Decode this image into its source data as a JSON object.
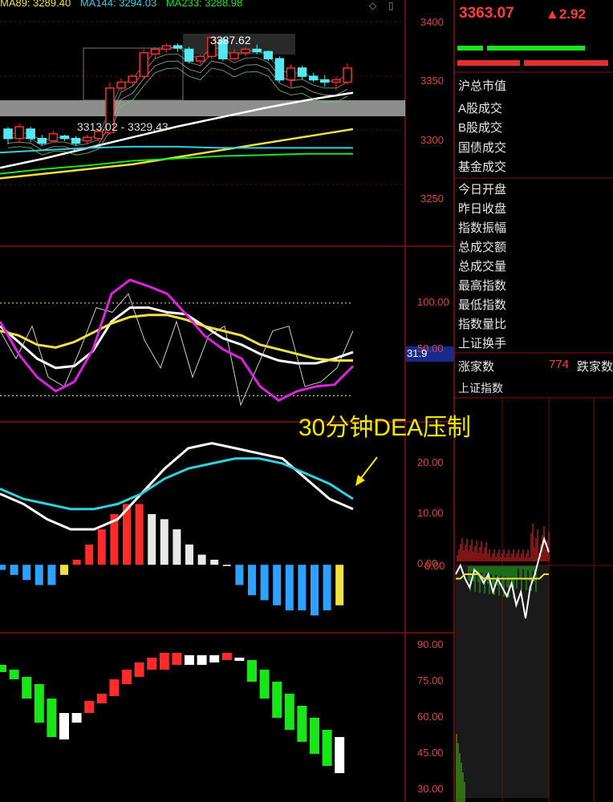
{
  "legend": {
    "ma89": "MA89: 3289.40",
    "ma144": "MA144: 3294.03",
    "ma233": "MA233: 3288.98"
  },
  "quote": {
    "price": "3363.07",
    "change": "▲2.92"
  },
  "stats_labels": [
    "沪总市值",
    "A股成交",
    "B股成交",
    "国债成交",
    "基金成交",
    "今日开盘",
    "昨日收盘",
    "指数振幅",
    "总成交额",
    "总成交量",
    "最高指数",
    "最低指数",
    "指数量比",
    "上证换手"
  ],
  "breadth": {
    "up_label": "涨家数",
    "up_value": "774",
    "down_label": "跌家数"
  },
  "mini_chart_title": "上证指数",
  "annotation": "30分钟DEA压制",
  "right_panel_axis": {
    "intraday_zero": "0.00"
  },
  "colors": {
    "up": "#ff2a2a",
    "down_candle": "#54e8f0",
    "white_line": "#ffffff",
    "yellow_line": "#f0e040",
    "magenta_line": "#e020e0",
    "cyan_line": "#30d0e0",
    "macd_neg": "#2ea0ff",
    "green_bar": "#19e619",
    "annotation": "#f5e600"
  },
  "chart_data": [
    {
      "type": "candlestick",
      "panel": "price",
      "annotations": [
        "3387.62",
        "3313.02 - 3329.43"
      ],
      "yticks": [
        3400,
        3350,
        3300,
        3250
      ],
      "ylim": [
        3215,
        3420
      ],
      "candles": [
        {
          "o": 3310,
          "c": 3302,
          "h": 3312,
          "l": 3297
        },
        {
          "o": 3302,
          "c": 3312,
          "h": 3315,
          "l": 3298
        },
        {
          "o": 3310,
          "c": 3302,
          "h": 3312,
          "l": 3299
        },
        {
          "o": 3302,
          "c": 3298,
          "h": 3305,
          "l": 3296
        },
        {
          "o": 3300,
          "c": 3306,
          "h": 3308,
          "l": 3299
        },
        {
          "o": 3304,
          "c": 3302,
          "h": 3305,
          "l": 3300
        },
        {
          "o": 3302,
          "c": 3298,
          "h": 3304,
          "l": 3296
        },
        {
          "o": 3300,
          "c": 3303,
          "h": 3305,
          "l": 3297
        },
        {
          "o": 3302,
          "c": 3308,
          "h": 3310,
          "l": 3300
        },
        {
          "o": 3307,
          "c": 3345,
          "h": 3350,
          "l": 3305
        },
        {
          "o": 3345,
          "c": 3350,
          "h": 3353,
          "l": 3342
        },
        {
          "o": 3350,
          "c": 3355,
          "h": 3357,
          "l": 3347
        },
        {
          "o": 3355,
          "c": 3375,
          "h": 3378,
          "l": 3352
        },
        {
          "o": 3374,
          "c": 3378,
          "h": 3380,
          "l": 3370
        },
        {
          "o": 3378,
          "c": 3381,
          "h": 3383,
          "l": 3375
        },
        {
          "o": 3381,
          "c": 3379,
          "h": 3383,
          "l": 3376
        },
        {
          "o": 3378,
          "c": 3368,
          "h": 3380,
          "l": 3366
        },
        {
          "o": 3368,
          "c": 3372,
          "h": 3374,
          "l": 3365
        },
        {
          "o": 3372,
          "c": 3388,
          "h": 3388,
          "l": 3370
        },
        {
          "o": 3386,
          "c": 3370,
          "h": 3388,
          "l": 3368
        },
        {
          "o": 3370,
          "c": 3375,
          "h": 3378,
          "l": 3368
        },
        {
          "o": 3375,
          "c": 3378,
          "h": 3380,
          "l": 3372
        },
        {
          "o": 3378,
          "c": 3376,
          "h": 3382,
          "l": 3374
        },
        {
          "o": 3376,
          "c": 3370,
          "h": 3377,
          "l": 3368
        },
        {
          "o": 3370,
          "c": 3352,
          "h": 3372,
          "l": 3350
        },
        {
          "o": 3352,
          "c": 3362,
          "h": 3365,
          "l": 3346
        },
        {
          "o": 3362,
          "c": 3355,
          "h": 3364,
          "l": 3352
        },
        {
          "o": 3355,
          "c": 3352,
          "h": 3358,
          "l": 3350
        },
        {
          "o": 3352,
          "c": 3350,
          "h": 3356,
          "l": 3346
        },
        {
          "o": 3350,
          "c": 3352,
          "h": 3355,
          "l": 3343
        },
        {
          "o": 3350,
          "c": 3362,
          "h": 3366,
          "l": 3348
        }
      ],
      "ma_series": [
        {
          "color": "#ffffff",
          "values": [
            3277,
            3285,
            3294,
            3303,
            3312,
            3320,
            3328,
            3335,
            3341
          ]
        },
        {
          "color": "#f0e040",
          "values": [
            3268,
            3272,
            3276,
            3280,
            3286,
            3292,
            3298,
            3304,
            3310
          ]
        },
        {
          "color": "#30d0e0",
          "values": [
            3290,
            3292,
            3294,
            3295,
            3295,
            3294,
            3294,
            3294,
            3294
          ]
        },
        {
          "color": "#19e619",
          "values": [
            3272,
            3276,
            3279,
            3283,
            3285,
            3287,
            3288,
            3289,
            3289
          ]
        }
      ]
    },
    {
      "type": "line",
      "panel": "kdj",
      "yticks": [
        100,
        50
      ],
      "current_label": "31.9",
      "ylim": [
        -10,
        150
      ],
      "series": [
        {
          "color": "#ffffff",
          "values": [
            75,
            58,
            40,
            30,
            32,
            48,
            80,
            95,
            95,
            90,
            88,
            75,
            62,
            55,
            45,
            38,
            35,
            35,
            40,
            47
          ]
        },
        {
          "color": "#f0e040",
          "values": [
            70,
            65,
            55,
            52,
            58,
            68,
            78,
            85,
            87,
            87,
            82,
            75,
            70,
            65,
            55,
            50,
            45,
            40,
            38,
            38
          ]
        },
        {
          "color": "#e020e0",
          "values": [
            80,
            45,
            20,
            5,
            15,
            50,
            110,
            125,
            118,
            110,
            88,
            65,
            50,
            40,
            10,
            -5,
            5,
            10,
            12,
            32
          ]
        }
      ],
      "j_raw": [
        70,
        40,
        75,
        20,
        10,
        50,
        95,
        90,
        110,
        60,
        30,
        80,
        20,
        65,
        75,
        -10,
        30,
        70,
        75,
        10,
        15,
        30,
        70
      ]
    },
    {
      "type": "bar+line",
      "panel": "macd",
      "yticks": [
        20,
        10,
        0
      ],
      "ylim": [
        -12,
        26
      ],
      "dif": [
        14,
        12,
        9,
        7,
        7,
        9,
        14,
        19,
        23,
        24,
        23,
        22,
        21,
        17,
        13,
        11
      ],
      "dea": [
        15,
        13,
        12,
        11,
        11,
        12,
        14,
        17,
        19,
        20,
        21,
        21,
        20,
        18,
        16,
        13
      ],
      "bars": [
        -1,
        -2,
        -3,
        -4,
        -4,
        -2,
        1,
        4,
        7,
        10,
        12,
        12,
        10,
        9,
        7,
        4,
        2,
        1,
        0,
        -4,
        -6,
        -7,
        -8,
        -9,
        -9,
        -10,
        -9,
        -8
      ],
      "bar_colors": [
        "#2ea0ff",
        "#2ea0ff",
        "#2ea0ff",
        "#2ea0ff",
        "#2ea0ff",
        "#f0e040",
        "#ff2a2a",
        "#ff2a2a",
        "#ff2a2a",
        "#ff2a2a",
        "#ff2a2a",
        "#ff2a2a",
        "#e8e8e8",
        "#e8e8e8",
        "#e8e8e8",
        "#e8e8e8",
        "#e8e8e8",
        "#e8e8e8",
        "#ffffff",
        "#2ea0ff",
        "#2ea0ff",
        "#2ea0ff",
        "#2ea0ff",
        "#2ea0ff",
        "#2ea0ff",
        "#2ea0ff",
        "#2ea0ff",
        "#f0e040"
      ]
    },
    {
      "type": "bar",
      "panel": "momentum",
      "yticks": [
        90,
        75,
        60,
        45,
        30
      ],
      "ylim": [
        25,
        95
      ],
      "bars": [
        {
          "top": 82,
          "bottom": 79,
          "color": "#19e619"
        },
        {
          "top": 80,
          "bottom": 76,
          "color": "#19e619"
        },
        {
          "top": 77,
          "bottom": 68,
          "color": "#19e619"
        },
        {
          "top": 74,
          "bottom": 58,
          "color": "#19e619"
        },
        {
          "top": 68,
          "bottom": 52,
          "color": "#19e619"
        },
        {
          "top": 62,
          "bottom": 51,
          "color": "#ffffff"
        },
        {
          "top": 62,
          "bottom": 58,
          "color": "#ffffff"
        },
        {
          "top": 67,
          "bottom": 62,
          "color": "#ff2a2a"
        },
        {
          "top": 70,
          "bottom": 66,
          "color": "#ff2a2a"
        },
        {
          "top": 76,
          "bottom": 69,
          "color": "#ff2a2a"
        },
        {
          "top": 80,
          "bottom": 74,
          "color": "#ff2a2a"
        },
        {
          "top": 83,
          "bottom": 77,
          "color": "#ff2a2a"
        },
        {
          "top": 85,
          "bottom": 80,
          "color": "#ff2a2a"
        },
        {
          "top": 87,
          "bottom": 80,
          "color": "#ff2a2a"
        },
        {
          "top": 87,
          "bottom": 82,
          "color": "#ff2a2a"
        },
        {
          "top": 86,
          "bottom": 82,
          "color": "#ffffff"
        },
        {
          "top": 86,
          "bottom": 82,
          "color": "#ffffff"
        },
        {
          "top": 86,
          "bottom": 83,
          "color": "#ffffff"
        },
        {
          "top": 87,
          "bottom": 84,
          "color": "#ff2a2a"
        },
        {
          "top": 85,
          "bottom": 84,
          "color": "#ffffff"
        },
        {
          "top": 84,
          "bottom": 75,
          "color": "#19e619"
        },
        {
          "top": 80,
          "bottom": 68,
          "color": "#19e619"
        },
        {
          "top": 75,
          "bottom": 60,
          "color": "#19e619"
        },
        {
          "top": 70,
          "bottom": 55,
          "color": "#19e619"
        },
        {
          "top": 65,
          "bottom": 50,
          "color": "#19e619"
        },
        {
          "top": 60,
          "bottom": 45,
          "color": "#19e619"
        },
        {
          "top": 55,
          "bottom": 40,
          "color": "#19e619"
        },
        {
          "top": 52,
          "bottom": 37,
          "color": "#ffffff"
        }
      ]
    },
    {
      "type": "line",
      "panel": "intraday",
      "series": [
        {
          "name": "price",
          "color": "#ffffff",
          "values": [
            -2,
            0,
            -3,
            -5,
            -1,
            -2,
            -4,
            -2,
            -6,
            -3,
            -5,
            -7,
            -4,
            -9,
            -6,
            -12,
            -5,
            -2,
            2,
            6,
            3
          ]
        },
        {
          "name": "average",
          "color": "#f0e040",
          "values": [
            -3,
            -3,
            -2,
            -2,
            -2,
            -2,
            -3,
            -3,
            -3,
            -3,
            -3,
            -3,
            -3,
            -3,
            -3,
            -3,
            -3,
            -3,
            -3,
            -2,
            -2
          ]
        }
      ],
      "ylim": [
        -15,
        10
      ]
    }
  ]
}
